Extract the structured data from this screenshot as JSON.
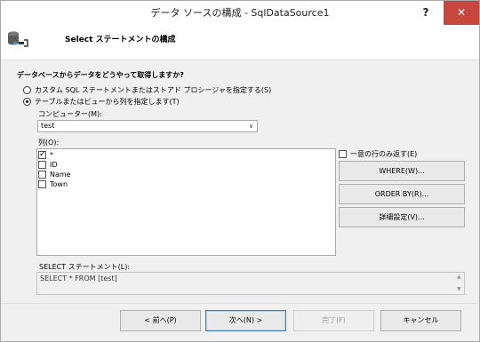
{
  "window": {
    "title": "データ ソースの構成 - SqlDataSource1",
    "help": "?",
    "close": "✕"
  },
  "header": {
    "title": "Select ステートメントの構成"
  },
  "question": "データベースからデータをどうやって取得しますか?",
  "options": [
    {
      "label": "カスタム SQL ステートメントまたはストアド プロシージャを指定する(S)",
      "selected": false
    },
    {
      "label": "テーブルまたはビューから列を指定します(T)",
      "selected": true
    }
  ],
  "computer": {
    "label": "コンピューター(M):",
    "value": "test"
  },
  "columns": {
    "label": "列(O):",
    "items": [
      {
        "label": "*",
        "checked": true
      },
      {
        "label": "ID",
        "checked": false
      },
      {
        "label": "Name",
        "checked": false
      },
      {
        "label": "Town",
        "checked": false
      }
    ]
  },
  "distinct": {
    "label": "一意の行のみ返す(E)",
    "checked": false
  },
  "side_buttons": {
    "where": "WHERE(W)...",
    "order_by": "ORDER BY(R)...",
    "advanced": "詳細設定(V)..."
  },
  "sql": {
    "label": "SELECT ステートメント(L):",
    "value": "SELECT * FROM [test]"
  },
  "footer": {
    "prev": "< 前へ(P)",
    "next": "次へ(N) >",
    "finish": "完了(F)",
    "cancel": "キャンセル"
  }
}
